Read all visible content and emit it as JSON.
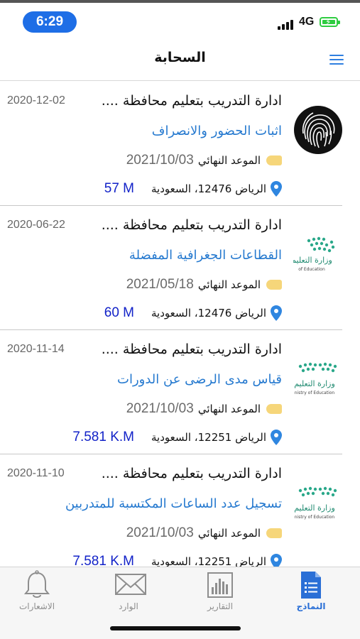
{
  "status_bar": {
    "time": "6:29",
    "network": "4G"
  },
  "header": {
    "title": "السحابة"
  },
  "cards": [
    {
      "title": "ادارة التدريب بتعليم محافظة ....",
      "date": "2020-12-02",
      "form_name": "اثبات الحضور والانصراف",
      "deadline_label": "الموعد النهائي",
      "deadline": "2021/10/03",
      "address": "الرياض 12476، السعودية",
      "distance": "57 M",
      "logo": "fingerprint-logo"
    },
    {
      "title": "ادارة التدريب بتعليم محافظة ....",
      "date": "2020-06-22",
      "form_name": "القطاعات الجغرافية المفضلة",
      "deadline_label": "الموعد النهائي",
      "deadline": "2021/05/18",
      "address": "الرياض 12476، السعودية",
      "distance": "60 M",
      "logo": "ministry-of-education-logo",
      "logo_text": "وزارة التعليم",
      "logo_subtext": "of Education"
    },
    {
      "title": "ادارة التدريب بتعليم محافظة ....",
      "date": "2020-11-14",
      "form_name": "قياس مدى الرضى عن الدورات",
      "deadline_label": "الموعد النهائي",
      "deadline": "2021/10/03",
      "address": "الرياض 12251، السعودية",
      "distance": "7.581 K.M",
      "logo": "ministry-of-education-logo",
      "logo_text": "وزارة التعليم",
      "logo_subtext": "nistry of Education"
    },
    {
      "title": "ادارة التدريب بتعليم محافظة ....",
      "date": "2020-11-10",
      "form_name": "تسجيل عدد الساعات المكتسبة للمتدربين",
      "deadline_label": "الموعد النهائي",
      "deadline": "2021/10/03",
      "address": "الرياض 12251، السعودية",
      "distance": "7.581 K.M",
      "logo": "ministry-of-education-logo",
      "logo_text": "وزارة التعليم",
      "logo_subtext": "nistry of Education"
    }
  ],
  "tab_bar": {
    "tabs": [
      {
        "label": "النماذج",
        "icon": "forms-icon",
        "active": true
      },
      {
        "label": "التقارير",
        "icon": "reports-icon",
        "active": false
      },
      {
        "label": "الوارد",
        "icon": "inbox-icon",
        "active": false
      },
      {
        "label": "الاشعارات",
        "icon": "bell-icon",
        "active": false
      }
    ]
  },
  "colors": {
    "accent": "#2a6fd6",
    "link": "#2579cf",
    "distance": "#1222c8",
    "deadline_tag": "#f6d67a",
    "pin": "#2f86e0",
    "logo_green": "#2aa88a"
  }
}
